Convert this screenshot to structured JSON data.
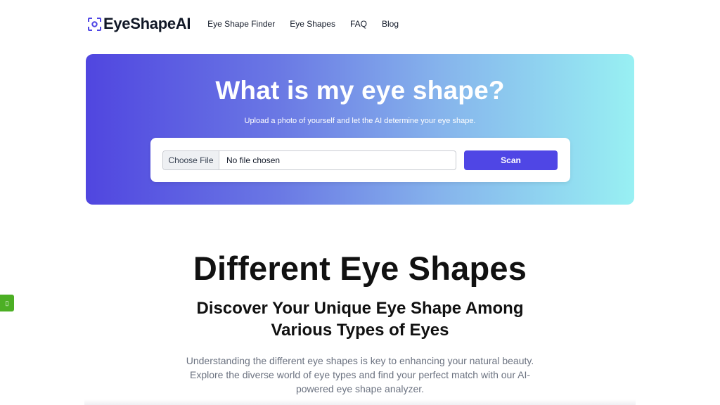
{
  "brand": {
    "name": "EyeShapeAI",
    "icon": "focus-eye-icon",
    "accent": "#4f46e5"
  },
  "nav": {
    "items": [
      {
        "label": "Eye Shape Finder"
      },
      {
        "label": "Eye Shapes"
      },
      {
        "label": "FAQ"
      },
      {
        "label": "Blog"
      }
    ]
  },
  "hero": {
    "title": "What is my eye shape?",
    "subtitle": "Upload a photo of yourself and let the AI determine your eye shape.",
    "file_button_label": "Choose File",
    "file_status": "No file chosen",
    "scan_label": "Scan",
    "gradient_start": "#5046e0",
    "gradient_end": "#98f0f3"
  },
  "section": {
    "title": "Different Eye Shapes",
    "subtitle": "Discover Your Unique Eye Shape Among Various Types of Eyes",
    "description": "Understanding the different eye shapes is key to enhancing your natural beauty. Explore the diverse world of eye types and find your perfect match with our AI-powered eye shape analyzer."
  },
  "side_widget": {
    "icon": "feedback-icon",
    "glyph": "▯",
    "color": "#4caf24"
  }
}
